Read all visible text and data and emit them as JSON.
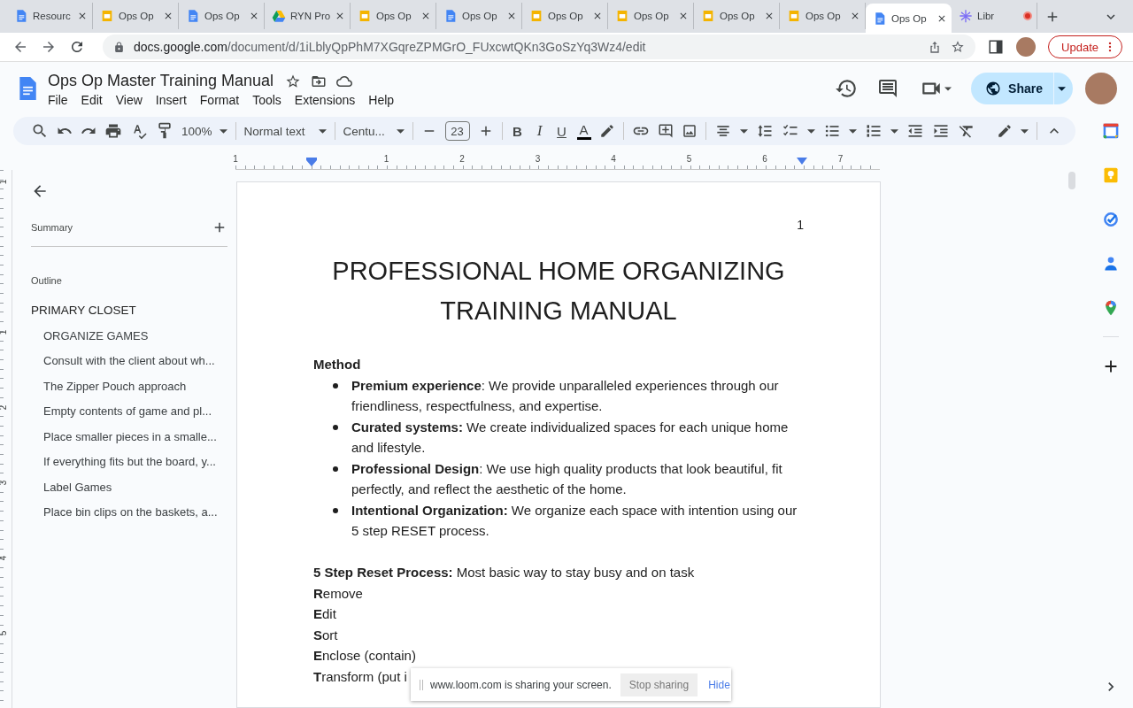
{
  "browser": {
    "tabs": [
      {
        "title": "Resourc",
        "kind": "docs",
        "selected": false,
        "recording": false
      },
      {
        "title": "Ops Op",
        "kind": "slides",
        "selected": false,
        "recording": false
      },
      {
        "title": "Ops Op",
        "kind": "docs",
        "selected": false,
        "recording": false
      },
      {
        "title": "RYN Pro",
        "kind": "drive",
        "selected": false,
        "recording": false
      },
      {
        "title": "Ops Op",
        "kind": "slides",
        "selected": false,
        "recording": false
      },
      {
        "title": "Ops Op",
        "kind": "docs",
        "selected": false,
        "recording": false
      },
      {
        "title": "Ops Op",
        "kind": "slides",
        "selected": false,
        "recording": false
      },
      {
        "title": "Ops Op",
        "kind": "slides",
        "selected": false,
        "recording": false
      },
      {
        "title": "Ops Op",
        "kind": "slides",
        "selected": false,
        "recording": false
      },
      {
        "title": "Ops Op",
        "kind": "slides",
        "selected": false,
        "recording": false
      },
      {
        "title": "Ops Op",
        "kind": "docs",
        "selected": true,
        "recording": false
      },
      {
        "title": "Libr",
        "kind": "spark",
        "selected": false,
        "recording": true
      }
    ],
    "url": {
      "host": "docs.google.com",
      "path": "/document/d/1iLblyQpPhM7XGqreZPMGrO_FUxcwtQKn3GoSzYq3Wz4/edit"
    },
    "update_button": "Update"
  },
  "document": {
    "title": "Ops Op Master Training Manual",
    "menus": [
      "File",
      "Edit",
      "View",
      "Insert",
      "Format",
      "Tools",
      "Extensions",
      "Help"
    ],
    "share_button": "Share"
  },
  "toolbar": {
    "zoom": "100%",
    "style": "Normal text",
    "font": "Centu...",
    "font_size": "23",
    "format_buttons": [
      "B",
      "I",
      "U"
    ],
    "text_color": "A"
  },
  "ruler": {
    "labels": [
      "1",
      "1",
      "2",
      "3",
      "4",
      "5",
      "6",
      "7"
    ]
  },
  "vertical_ruler": {
    "labels": [
      "1",
      "1",
      "2",
      "3",
      "4",
      "5"
    ]
  },
  "sidebar": {
    "summary_label": "Summary",
    "outline_label": "Outline",
    "outline": [
      {
        "text": "PRIMARY CLOSET",
        "children": [
          {
            "text": "ORGANIZE GAMES"
          },
          {
            "text": "Consult with the client about wh..."
          },
          {
            "text": "The Zipper Pouch approach"
          },
          {
            "text": "Empty contents of game and pl..."
          },
          {
            "text": "Place smaller pieces in a smalle..."
          },
          {
            "text": "If everything fits but the board, y..."
          },
          {
            "text": "Label Games"
          },
          {
            "text": "Place bin clips on the baskets, a..."
          }
        ]
      }
    ]
  },
  "page": {
    "page_number": "1",
    "title": "PROFESSIONAL HOME ORGANIZING TRAINING MANUAL",
    "method_heading": "Method",
    "bullets": [
      "**Premium experience**: We provide unparalleled experiences through our friendliness, respectfulness, and expertise.",
      "**Curated systems:** We create individualized spaces for each unique home and lifestyle.",
      "**Professional Design**: We use high quality products that look beautiful, fit perfectly, and reflect the aesthetic of the home.",
      "**Intentional Organization:** We organize each space with intention using our 5 step RESET process."
    ],
    "reset_lines": [
      "**5 Step Reset Process:** Most basic way to stay busy and on task",
      "**R**emove",
      "**E**dit",
      "**S**ort",
      "**E**nclose (contain)",
      "**T**ransform (put i"
    ]
  },
  "sharing_bar": {
    "message": "www.loom.com is sharing your screen.",
    "stop_button": "Stop sharing",
    "hide_link": "Hide"
  }
}
